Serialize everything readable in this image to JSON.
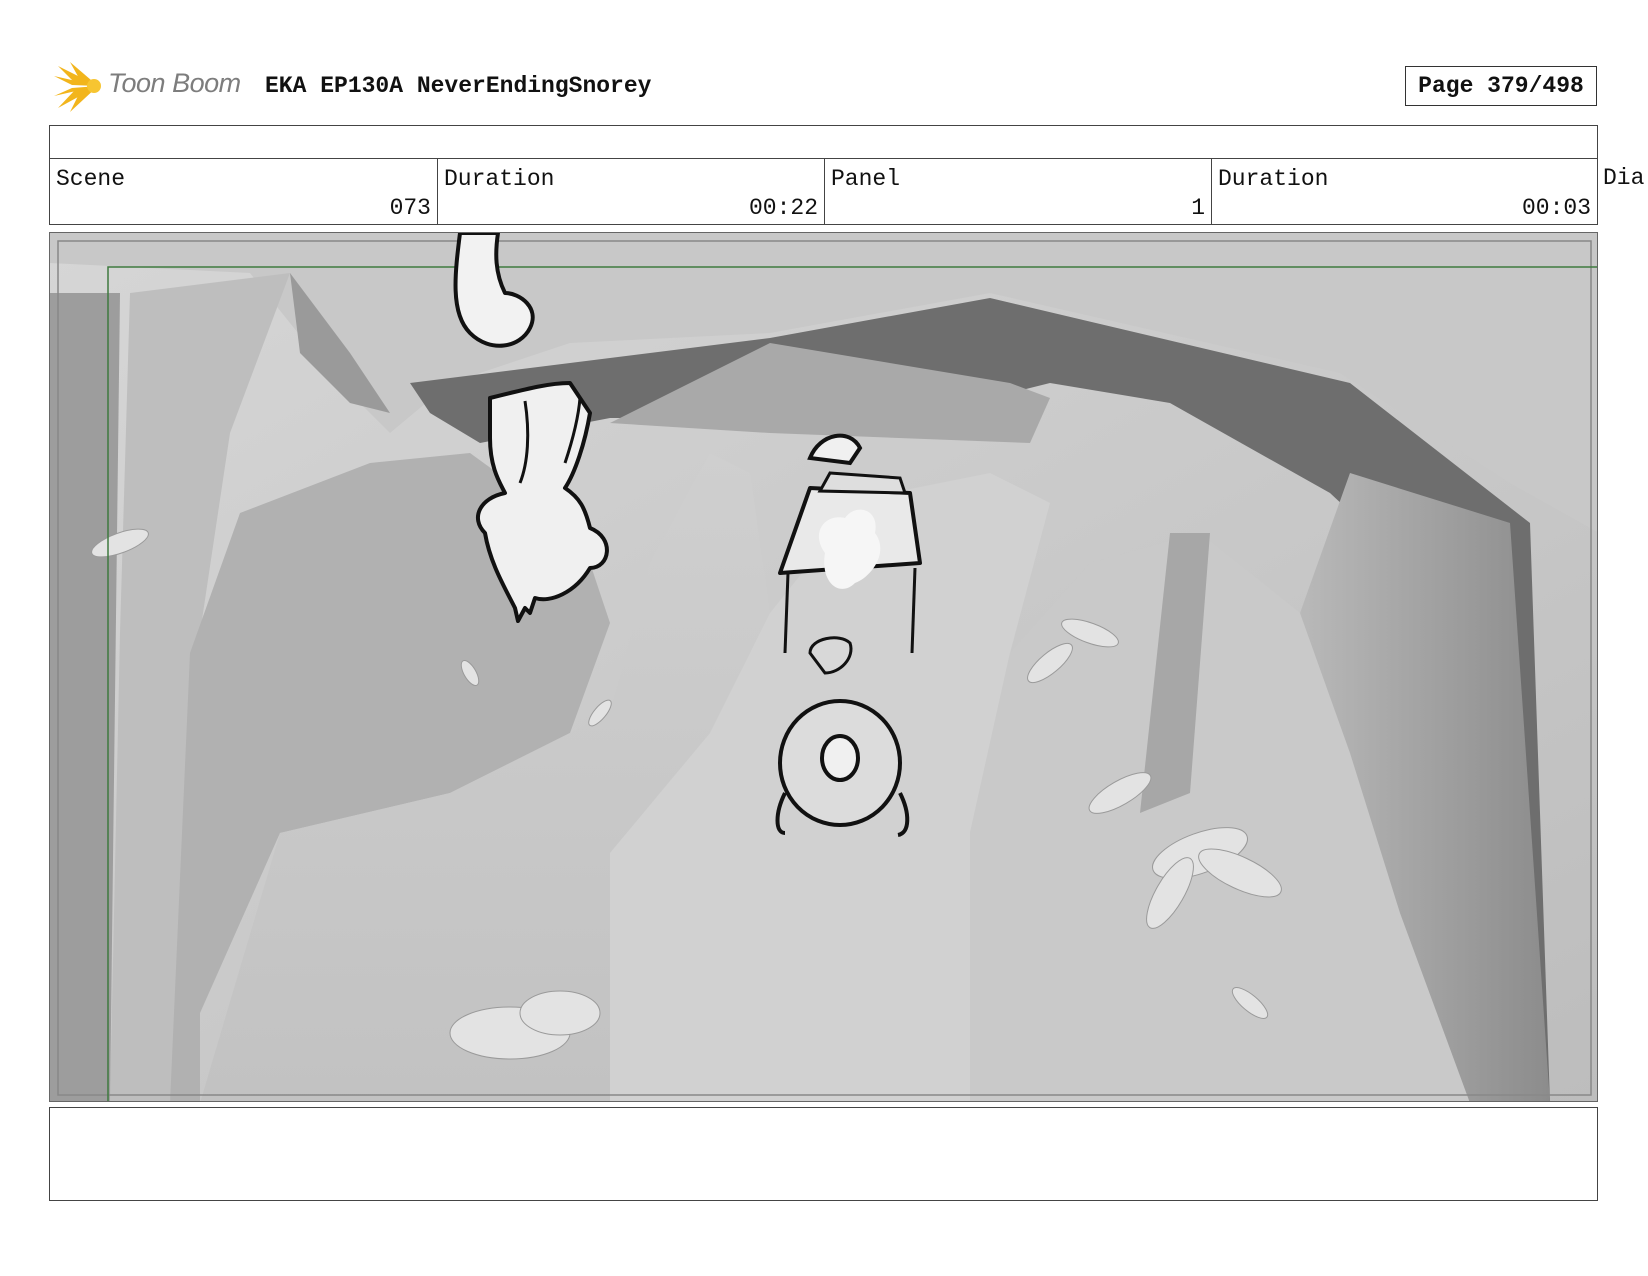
{
  "header": {
    "logo_text": "Toon Boom",
    "title": "EKA EP130A NeverEndingSnorey",
    "page": "Page 379/498"
  },
  "fields": [
    {
      "label": "Scene",
      "value": "073"
    },
    {
      "label": "Duration",
      "value": "00:22"
    },
    {
      "label": "Panel",
      "value": "1"
    },
    {
      "label": "Duration",
      "value": "00:03"
    }
  ],
  "cut_off_label": "Dia",
  "colors": {
    "logo_flare": "#f2b51c",
    "safe_area_line": "#3f7a3f"
  }
}
